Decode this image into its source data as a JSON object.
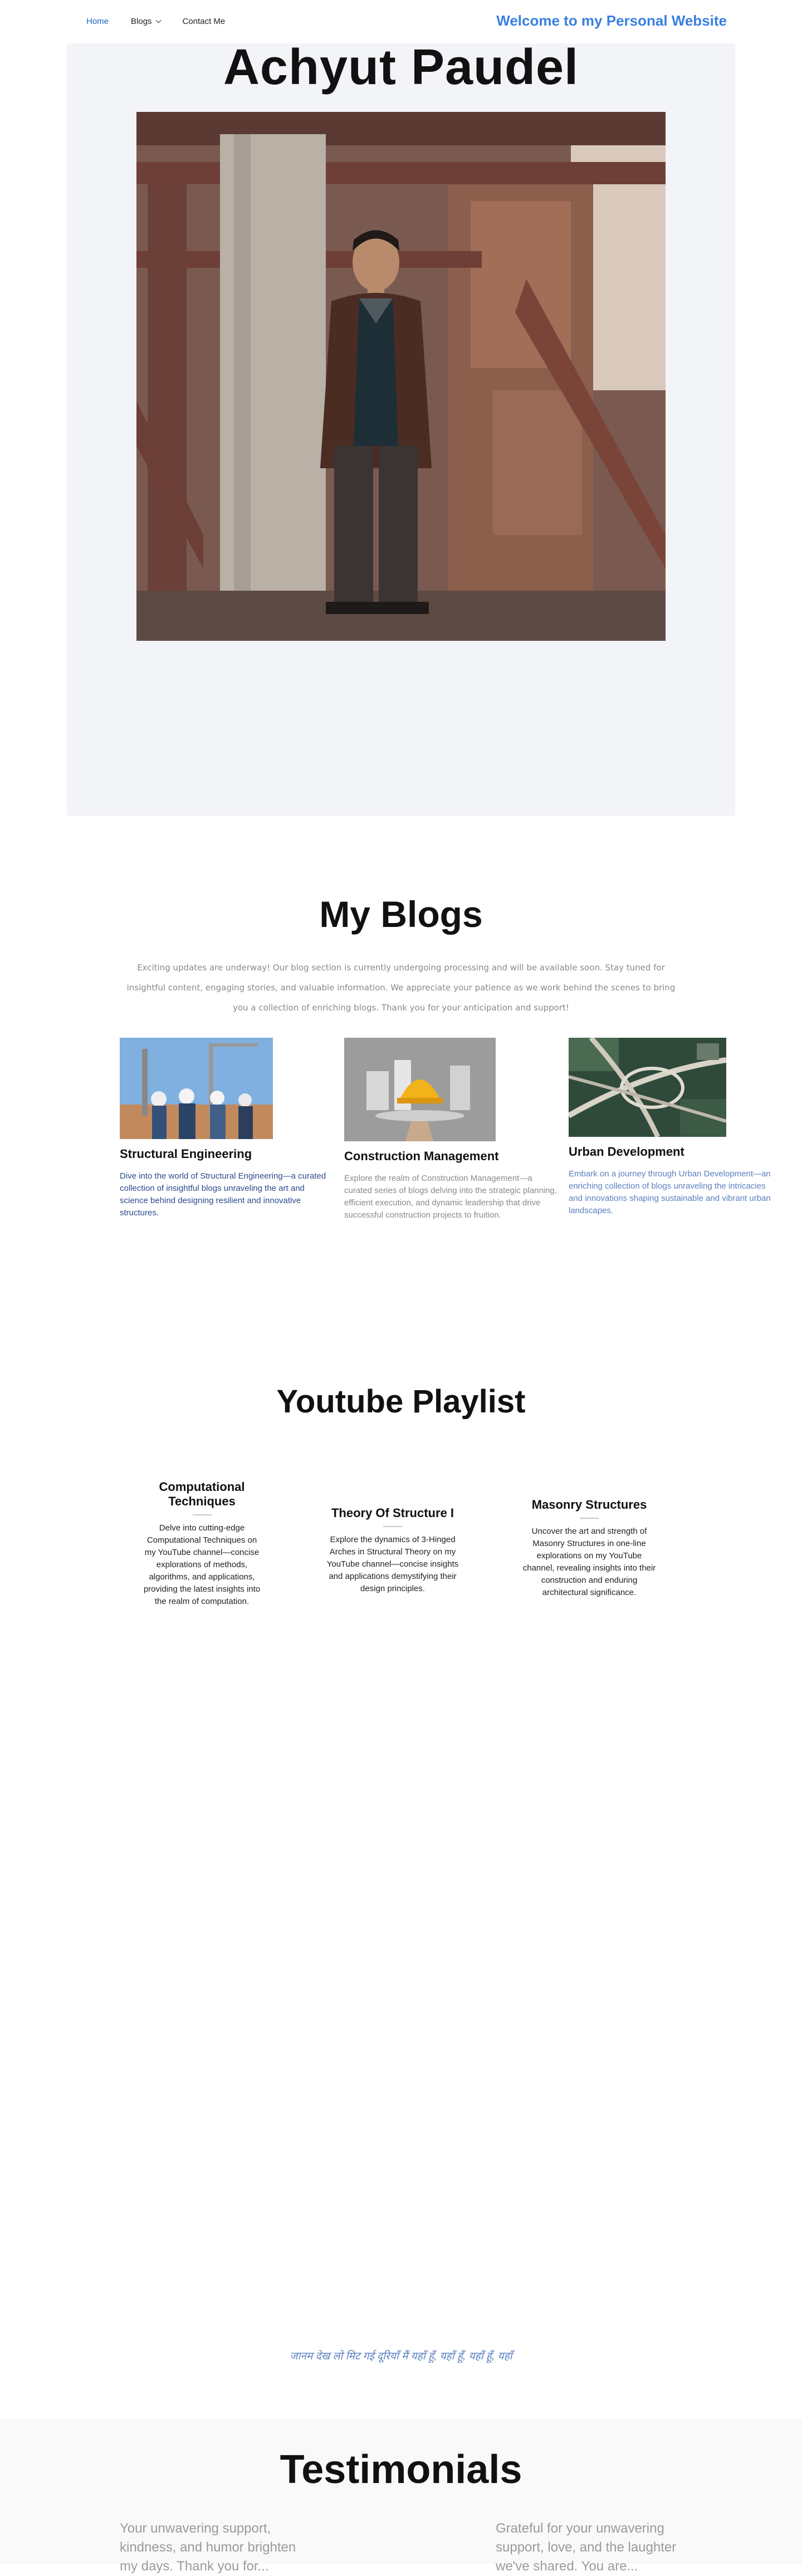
{
  "nav": {
    "links": [
      {
        "label": "Home"
      },
      {
        "label": "Blogs"
      },
      {
        "label": "Contact Me"
      }
    ],
    "welcome": "Welcome to my Personal Website"
  },
  "hero": {
    "name": "Achyut Paudel"
  },
  "blogs": {
    "heading": "My Blogs",
    "intro": "Exciting updates are underway! Our blog section is currently undergoing processing and will be available soon. Stay tuned for insightful content, engaging stories, and valuable information. We appreciate your patience as we work behind the scenes to bring you a collection of enriching blogs. Thank you for your anticipation and support!",
    "cards": [
      {
        "title": "Structural Engineering",
        "desc": "Dive into the world of Structural Engineering—a curated collection of insightful blogs unraveling the art and science behind designing resilient and innovative structures.",
        "color": "#2b4a8c"
      },
      {
        "title": "Construction Management",
        "desc": "Explore the realm of Construction Management—a curated series of blogs delving into the strategic planning, efficient execution, and dynamic leadership that drive successful construction projects to fruition.",
        "color": "#8a8a8a"
      },
      {
        "title": "Urban Development",
        "desc": "Embark on a journey through Urban Development—an enriching collection of blogs unraveling the intricacies and innovations shaping sustainable and vibrant urban landscapes.",
        "color": "#5a7fc0"
      }
    ]
  },
  "youtube": {
    "heading": "Youtube Playlist",
    "items": [
      {
        "title": "Computational Techniques",
        "desc": "Delve into cutting-edge Computational Techniques on my YouTube channel—concise explorations of methods, algorithms, and applications, providing the latest insights into the realm of computation."
      },
      {
        "title": "Theory Of Structure I",
        "desc": "Explore the dynamics of 3-Hinged Arches in Structural Theory on my YouTube channel—concise insights and applications demystifying their design principles."
      },
      {
        "title": "Masonry Structures",
        "desc": "Uncover the art and strength of Masonry Structures in one-line explorations on my YouTube channel, revealing insights into their construction and enduring architectural significance."
      }
    ]
  },
  "quote": "जानम देख लो मिट गई दूरियाँ मैं यहाँ हूँ, यहाँ हूँ, यहाँ हूँ, यहाँ",
  "testimonials": {
    "heading": "Testimonials",
    "items": [
      {
        "text": "Your unwavering support, kindness, and humor brighten my days. Thank you for..."
      },
      {
        "text": "Grateful for your unwavering support, love, and the laughter we've shared. You are..."
      }
    ]
  },
  "colors": {
    "accent": "#3a7fe0",
    "active_link": "#1e64c8",
    "hero_bg": "#f3f4f8"
  }
}
